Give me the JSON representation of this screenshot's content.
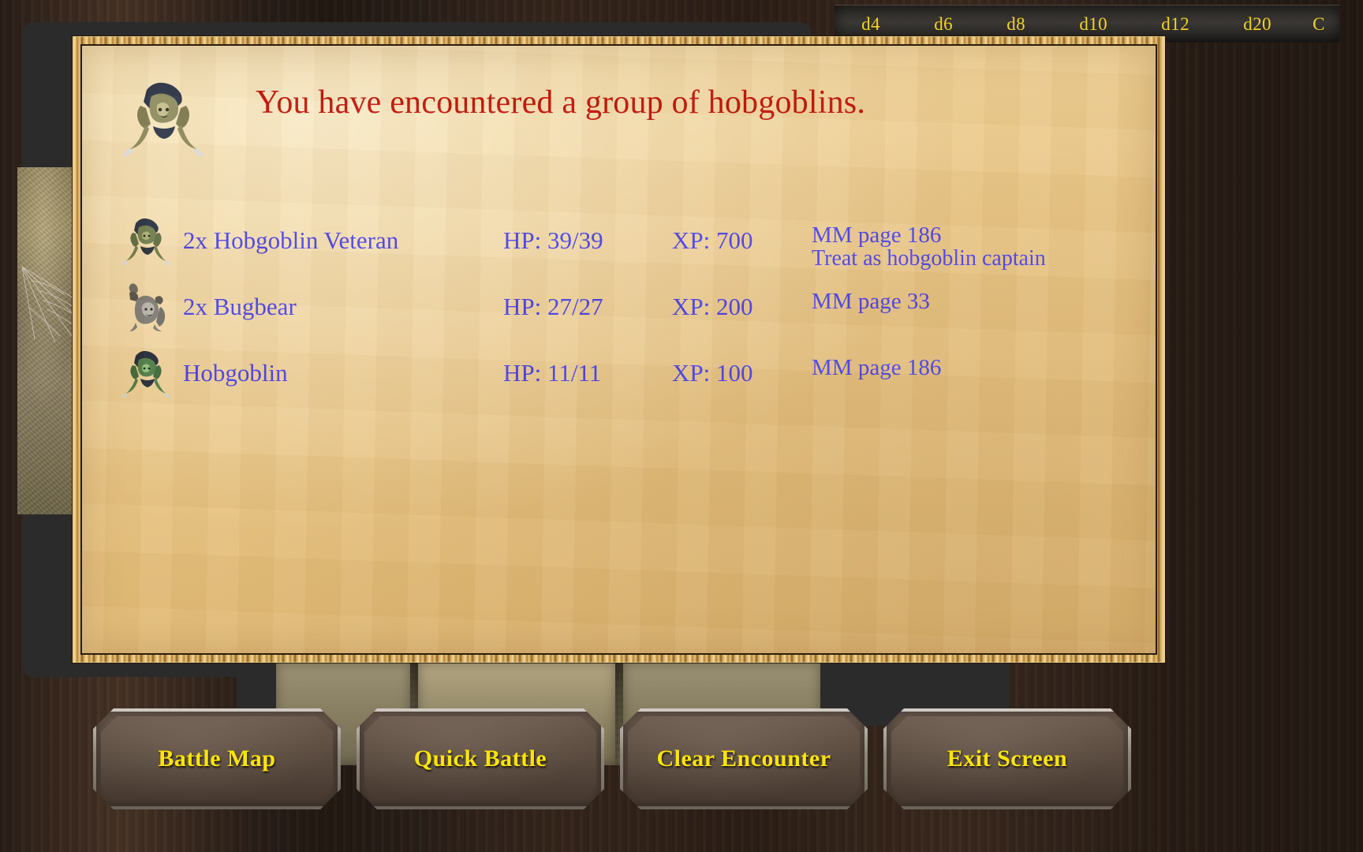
{
  "dice_toolbar": {
    "buttons": [
      {
        "label": "d4",
        "name": "dice-d4"
      },
      {
        "label": "d6",
        "name": "dice-d6"
      },
      {
        "label": "d8",
        "name": "dice-d8"
      },
      {
        "label": "d10",
        "name": "dice-d10"
      },
      {
        "label": "d12",
        "name": "dice-d12"
      },
      {
        "label": "d20",
        "name": "dice-d20"
      },
      {
        "label": "C",
        "name": "dice-clear"
      }
    ]
  },
  "dialog": {
    "title": "You have encountered a group of hobgoblins.",
    "title_color": "#c21408",
    "text_color": "#4a42e8",
    "monsters": [
      {
        "name": "2x Hobgoblin Veteran",
        "hp": "HP: 39/39",
        "xp": "XP: 700",
        "reference": "MM page 186",
        "note": "Treat as hobgoblin captain",
        "sprite": "hobgoblin-veteran-sprite"
      },
      {
        "name": "2x Bugbear",
        "hp": "HP: 27/27",
        "xp": "XP: 200",
        "reference": "MM page 33",
        "note": "",
        "sprite": "bugbear-sprite"
      },
      {
        "name": "Hobgoblin",
        "hp": "HP: 11/11",
        "xp": "XP: 100",
        "reference": "MM page 186",
        "note": "",
        "sprite": "hobgoblin-sprite"
      }
    ]
  },
  "buttons": [
    {
      "label": "Battle Map",
      "name": "battle-map-button"
    },
    {
      "label": "Quick Battle",
      "name": "quick-battle-button"
    },
    {
      "label": "Clear Encounter",
      "name": "clear-encounter-button"
    },
    {
      "label": "Exit Screen",
      "name": "exit-screen-button"
    }
  ],
  "theme": {
    "button_text_color": "#ffe500",
    "parchment_color": "#e8c483",
    "frame_gold": "#d9ae5e"
  }
}
